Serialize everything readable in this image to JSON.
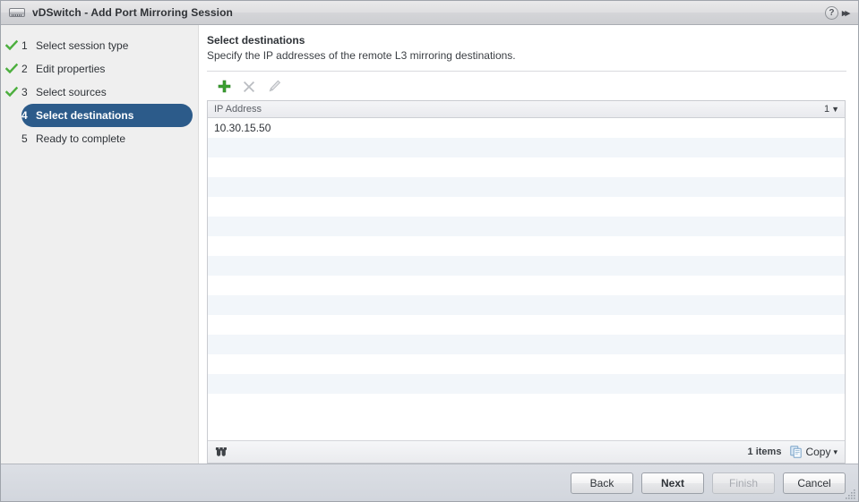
{
  "window": {
    "title": "vDSwitch - Add Port Mirroring Session",
    "icon": "switch-icon",
    "help_icon": "?",
    "expand_icon": "▸▸"
  },
  "sidebar": {
    "steps": [
      {
        "num": "1",
        "label": "Select session type",
        "completed": true,
        "active": false
      },
      {
        "num": "2",
        "label": "Edit properties",
        "completed": true,
        "active": false
      },
      {
        "num": "3",
        "label": "Select sources",
        "completed": true,
        "active": false
      },
      {
        "num": "4",
        "label": "Select destinations",
        "completed": false,
        "active": true
      },
      {
        "num": "5",
        "label": "Ready to complete",
        "completed": false,
        "active": false
      }
    ]
  },
  "content": {
    "heading": "Select destinations",
    "subheading": "Specify the IP addresses of the remote L3 mirroring destinations.",
    "toolbar": {
      "add_label": "Add",
      "remove_label": "Remove",
      "edit_label": "Edit"
    },
    "table": {
      "column_header": "IP Address",
      "column_count": "1",
      "sort_caret": "▼",
      "rows": [
        {
          "ip_address": "10.30.15.50"
        }
      ],
      "empty_row_count": 14,
      "footer": {
        "filter_icon": "binoculars-icon",
        "item_count": "1 items",
        "copy_label": "Copy",
        "copy_caret": "▾"
      }
    }
  },
  "footer": {
    "buttons": [
      {
        "label": "Back",
        "state": "enabled"
      },
      {
        "label": "Next",
        "state": "default"
      },
      {
        "label": "Finish",
        "state": "disabled"
      },
      {
        "label": "Cancel",
        "state": "enabled"
      }
    ]
  },
  "colors": {
    "active_step": "#2c5b8a",
    "check_green": "#4caf3e",
    "add_green": "#3aa030",
    "row_stripe": "#f2f6fa",
    "titlebar": "#d9dadd",
    "footer_bar": "#d6dae1"
  }
}
